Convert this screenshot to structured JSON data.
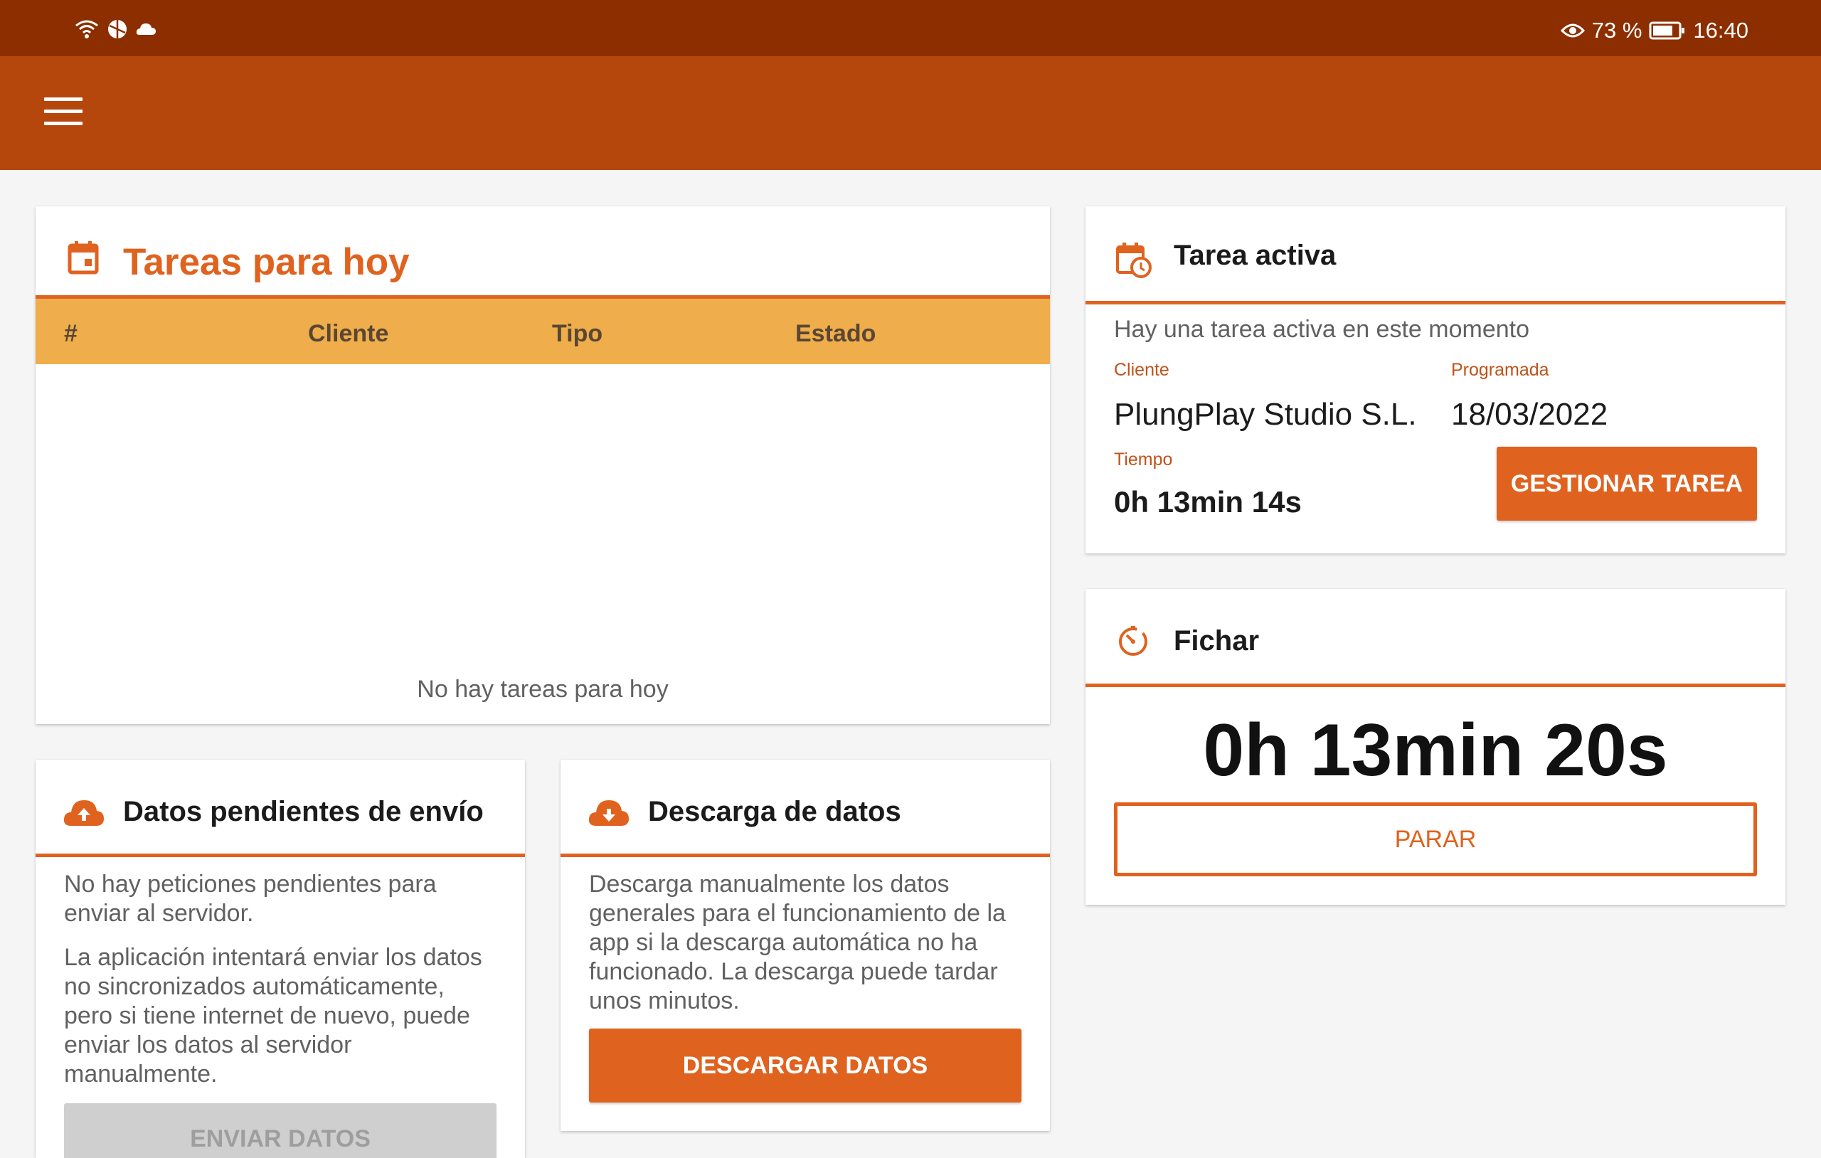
{
  "status_bar": {
    "battery_percent": "73 %",
    "time": "16:40",
    "icons": [
      "wifi-icon",
      "vpn-icon",
      "cloud-icon",
      "eye-icon",
      "battery-icon"
    ]
  },
  "app_bar": {
    "menu_icon": "hamburger-menu-icon"
  },
  "colors": {
    "accent": "#e0621f",
    "app_bar": "#b5470d",
    "status_bar": "#8c2e00",
    "table_header": "#efae4b"
  },
  "tasks_today": {
    "title": "Tareas para hoy",
    "columns": [
      "#",
      "Cliente",
      "Tipo",
      "Estado"
    ],
    "rows": [],
    "empty_message": "No hay tareas para hoy"
  },
  "active_task": {
    "title": "Tarea activa",
    "message": "Hay una tarea activa en este momento",
    "client_label": "Cliente",
    "client_value": "PlungPlay Studio S.L.",
    "scheduled_label": "Programada",
    "scheduled_value": "18/03/2022",
    "time_label": "Tiempo",
    "time_value": "0h 13min 14s",
    "manage_button": "GESTIONAR TAREA"
  },
  "clock_in": {
    "title": "Fichar",
    "timer": "0h 13min 20s",
    "stop_button": "PARAR"
  },
  "pending_data": {
    "title": "Datos pendientes de envío",
    "text1": "No hay peticiones pendientes para enviar al servidor.",
    "text2": "La aplicación intentará enviar los datos no sincronizados automáticamente, pero si tiene internet de nuevo, puede enviar los datos al servidor manualmente.",
    "send_button": "ENVIAR DATOS"
  },
  "download_data": {
    "title": "Descarga de datos",
    "text": "Descarga manualmente los datos generales para el funcionamiento de la app si la descarga automática no ha funcionado. La descarga puede tardar unos minutos.",
    "download_button": "DESCARGAR DATOS"
  }
}
